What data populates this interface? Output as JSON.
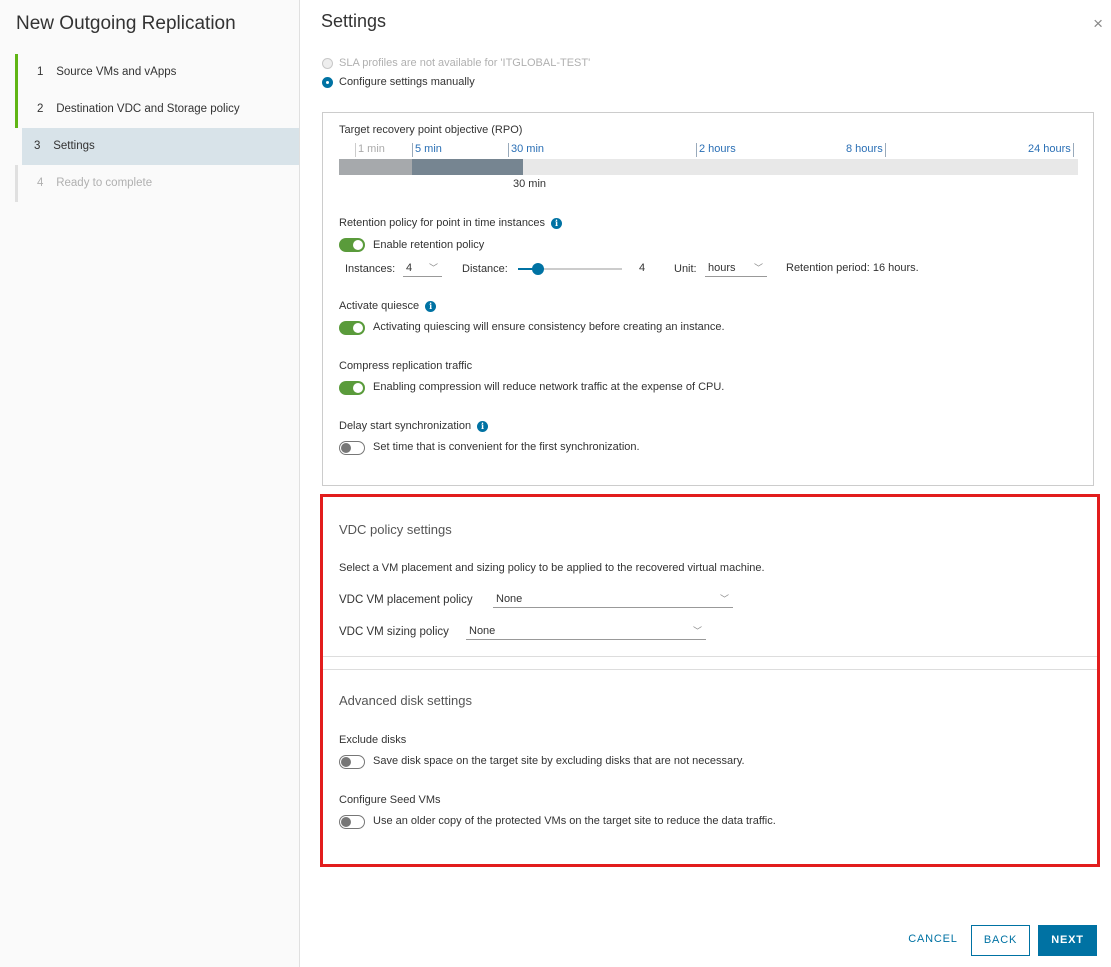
{
  "wizard": {
    "title": "New Outgoing Replication",
    "steps": [
      {
        "num": "1",
        "label": "Source VMs and vApps"
      },
      {
        "num": "2",
        "label": "Destination VDC and Storage policy"
      },
      {
        "num": "3",
        "label": "Settings"
      },
      {
        "num": "4",
        "label": "Ready to complete"
      }
    ]
  },
  "page": {
    "title": "Settings",
    "close": "×"
  },
  "sla": {
    "unavailable_text": "SLA profiles are not available for 'ITGLOBAL-TEST'",
    "manual_text": "Configure settings manually"
  },
  "rpo": {
    "title": "Target recovery point objective (RPO)",
    "ticks": [
      "1 min",
      "5 min",
      "30 min",
      "2 hours",
      "8 hours",
      "24 hours"
    ],
    "value": "30 min"
  },
  "retention": {
    "title": "Retention policy for point in time instances",
    "toggle_label": "Enable retention policy",
    "instances_label": "Instances:",
    "instances_value": "4",
    "distance_label": "Distance:",
    "distance_value": "4",
    "unit_label": "Unit:",
    "unit_value": "hours",
    "period_text": "Retention period: 16 hours."
  },
  "quiesce": {
    "title": "Activate quiesce",
    "toggle_label": "Activating quiescing will ensure consistency before creating an instance."
  },
  "compress": {
    "title": "Compress replication traffic",
    "toggle_label": "Enabling compression will reduce network traffic at the expense of CPU."
  },
  "delay": {
    "title": "Delay start synchronization",
    "toggle_label": "Set time that is convenient for the first synchronization."
  },
  "vdc_policy": {
    "title": "VDC policy settings",
    "description": "Select a VM placement and sizing policy to be applied to the recovered virtual machine.",
    "placement_label": "VDC VM placement policy",
    "placement_value": "None",
    "sizing_label": "VDC VM sizing policy",
    "sizing_value": "None"
  },
  "advanced_disk": {
    "title": "Advanced disk settings",
    "exclude_title": "Exclude disks",
    "exclude_toggle_label": "Save disk space on the target site by excluding disks that are not necessary.",
    "seed_title": "Configure Seed VMs",
    "seed_toggle_label": "Use an older copy of the protected VMs on the target site to reduce the data traffic."
  },
  "footer": {
    "cancel": "CANCEL",
    "back": "BACK",
    "next": "NEXT"
  },
  "colors": {
    "accent": "#0072a3",
    "toggle_on": "#5a9b3b",
    "step_done": "#60b515",
    "highlight": "#e21d1d"
  }
}
